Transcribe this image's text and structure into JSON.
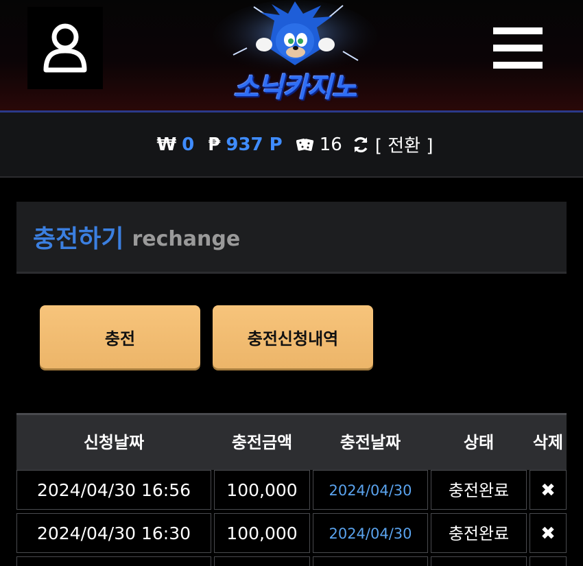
{
  "header": {
    "logo_text": "소닉카지노",
    "user_icon": "user-icon",
    "menu_icon": "hamburger-menu-icon"
  },
  "balance": {
    "won_symbol": "₩",
    "won_value": "0",
    "point_symbol": "₱",
    "point_value": "937 P",
    "dice_icon": "dice-icon",
    "dice_value": "16",
    "refresh_icon": "refresh-icon",
    "convert_label": "[ 전환 ]"
  },
  "section": {
    "title": "충전하기",
    "subtitle": "rechange"
  },
  "buttons": {
    "charge_label": "충전",
    "history_label": "충전신청내역"
  },
  "table": {
    "headers": [
      "신청날짜",
      "충전금액",
      "충전날짜",
      "상태",
      "삭제"
    ],
    "rows": [
      {
        "request_date": "2024/04/30 16:56",
        "amount": "100,000",
        "charge_date": "2024/04/30",
        "status": "충전완료",
        "delete": "✖"
      },
      {
        "request_date": "2024/04/30 16:30",
        "amount": "100,000",
        "charge_date": "2024/04/30",
        "status": "충전완료",
        "delete": "✖"
      }
    ]
  },
  "colors": {
    "accent_blue": "#3f8cff",
    "button_gold": "#f2bc70",
    "background": "#000000"
  }
}
